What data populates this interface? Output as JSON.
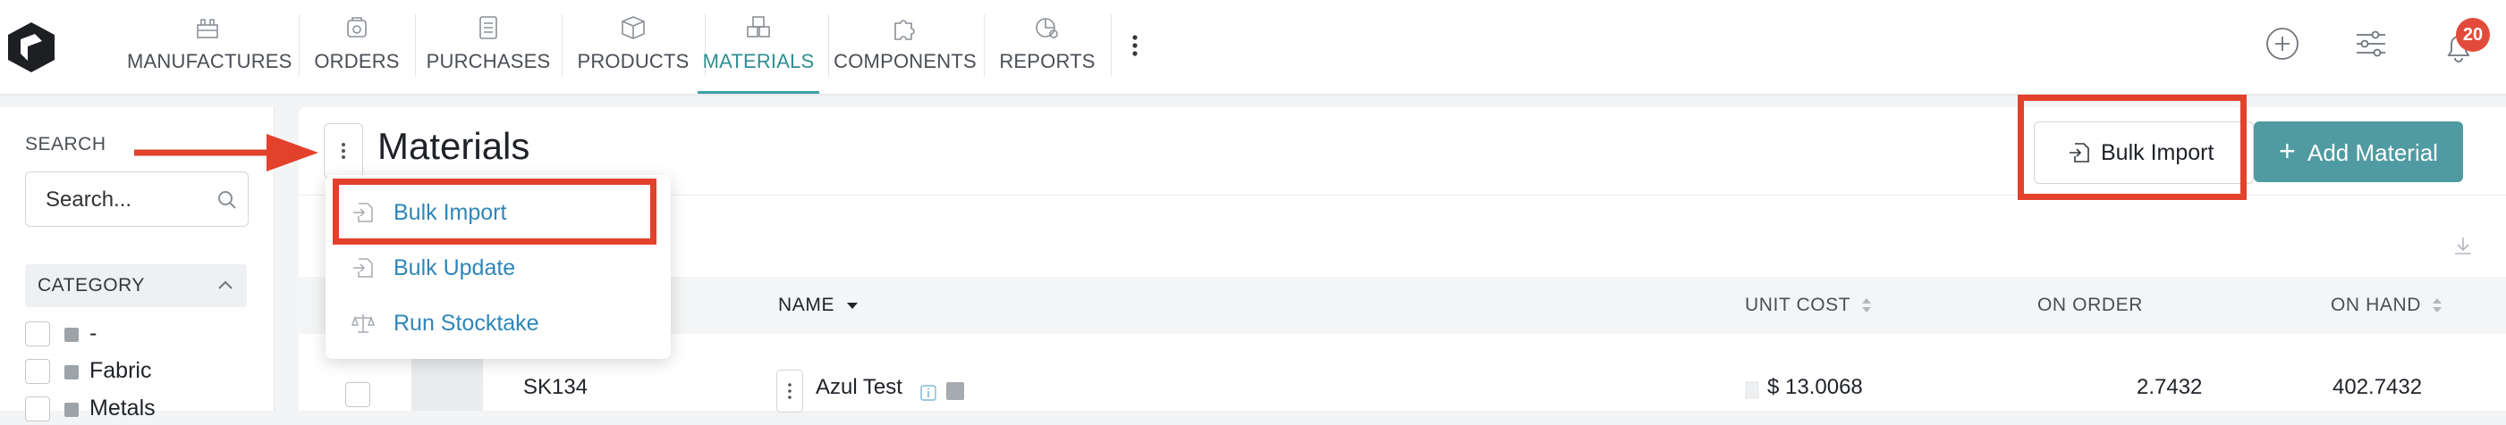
{
  "nav": {
    "items": [
      {
        "label": "MANUFACTURES",
        "icon": "factory-icon"
      },
      {
        "label": "ORDERS",
        "icon": "cart-icon"
      },
      {
        "label": "PURCHASES",
        "icon": "clipboard-icon"
      },
      {
        "label": "PRODUCTS",
        "icon": "box-icon"
      },
      {
        "label": "MATERIALS",
        "icon": "materials-icon",
        "active": true
      },
      {
        "label": "COMPONENTS",
        "icon": "puzzle-icon"
      },
      {
        "label": "REPORTS",
        "icon": "chart-icon"
      }
    ],
    "more_icon": "vertical-dots-icon",
    "notification_count": "20",
    "accent_color": "#3fa2a6"
  },
  "sidebar": {
    "search_label": "SEARCH",
    "search_placeholder": "Search...",
    "category_label": "CATEGORY",
    "categories": [
      "-",
      "Fabric",
      "Metals"
    ]
  },
  "main": {
    "title": "Materials",
    "bulk_import_label": "Bulk Import",
    "add_material_label": "Add Material",
    "add_color": "#4f9ba1",
    "columns": {
      "name": "NAME",
      "unit_cost": "UNIT COST",
      "on_order": "ON ORDER",
      "on_hand": "ON HAND"
    },
    "rows": [
      {
        "sku": "SK134",
        "name": "Azul Test",
        "unit_cost": "$ 13.0068",
        "on_order": "2.7432",
        "on_hand": "402.7432"
      }
    ]
  },
  "dropdown": {
    "items": [
      {
        "label": "Bulk Import"
      },
      {
        "label": "Bulk Update"
      },
      {
        "label": "Run Stocktake"
      }
    ],
    "link_color": "#2f86b8"
  },
  "annotation_color": "#e2412b"
}
